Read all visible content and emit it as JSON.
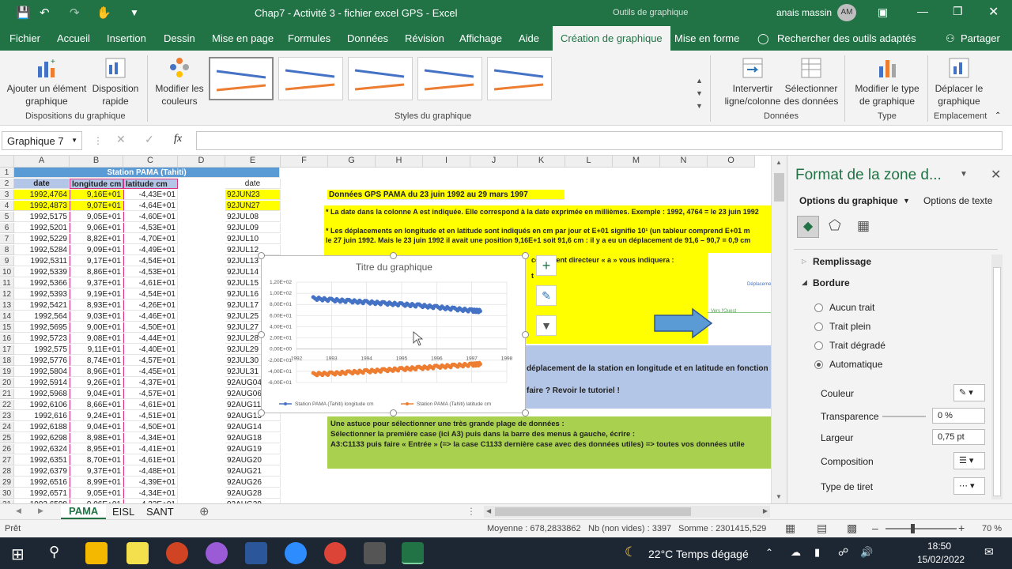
{
  "window": {
    "title": "Chap7 - Activité 3 - fichier excel GPS  -  Excel",
    "context_tools": "Outils de graphique",
    "user": "anais massin",
    "user_initials": "AM"
  },
  "menu": {
    "tabs": [
      "Fichier",
      "Accueil",
      "Insertion",
      "Dessin",
      "Mise en page",
      "Formules",
      "Données",
      "Révision",
      "Affichage",
      "Aide",
      "Création de graphique",
      "Mise en forme"
    ],
    "search": "Rechercher des outils adaptés",
    "share": "Partager"
  },
  "ribbon": {
    "add_element": "Ajouter un élément graphique",
    "quick_layout": "Disposition rapide",
    "group1": "Dispositions du graphique",
    "change_colors": "Modifier les couleurs",
    "group2": "Styles du graphique",
    "switch_row_col": "Intervertir ligne/colonne",
    "select_data": "Sélectionner des données",
    "group3": "Données",
    "change_type": "Modifier le type de graphique",
    "group4": "Type",
    "move_chart": "Déplacer le graphique",
    "group5": "Emplacement"
  },
  "formula": {
    "namebox": "Graphique 7",
    "fx": "fx",
    "value": ""
  },
  "columns": [
    "A",
    "B",
    "C",
    "D",
    "E",
    "F",
    "G",
    "H",
    "I",
    "J",
    "K",
    "L",
    "M",
    "N",
    "O"
  ],
  "header_row1": "Station  PAMA (Tahiti)",
  "header_row2": {
    "a": "date",
    "b": "longitude cm",
    "c": "latitude cm",
    "e": "date"
  },
  "rows": [
    {
      "n": "3",
      "a": "1992,4764",
      "b": "9,16E+01",
      "c": "-4,43E+01",
      "e": "92JUN23"
    },
    {
      "n": "4",
      "a": "1992,4873",
      "b": "9,07E+01",
      "c": "-4,64E+01",
      "e": "92JUN27"
    },
    {
      "n": "5",
      "a": "1992,5175",
      "b": "9,05E+01",
      "c": "-4,60E+01",
      "e": "92JUL08"
    },
    {
      "n": "6",
      "a": "1992,5201",
      "b": "9,06E+01",
      "c": "-4,53E+01",
      "e": "92JUL09"
    },
    {
      "n": "7",
      "a": "1992,5229",
      "b": "8,82E+01",
      "c": "-4,70E+01",
      "e": "92JUL10"
    },
    {
      "n": "8",
      "a": "1992,5284",
      "b": "9,09E+01",
      "c": "-4,49E+01",
      "e": "92JUL12"
    },
    {
      "n": "9",
      "a": "1992,5311",
      "b": "9,17E+01",
      "c": "-4,54E+01",
      "e": "92JUL13"
    },
    {
      "n": "10",
      "a": "1992,5339",
      "b": "8,86E+01",
      "c": "-4,53E+01",
      "e": "92JUL14"
    },
    {
      "n": "11",
      "a": "1992,5366",
      "b": "9,37E+01",
      "c": "-4,61E+01",
      "e": "92JUL15"
    },
    {
      "n": "12",
      "a": "1992,5393",
      "b": "9,19E+01",
      "c": "-4,54E+01",
      "e": "92JUL16"
    },
    {
      "n": "13",
      "a": "1992,5421",
      "b": "8,93E+01",
      "c": "-4,26E+01",
      "e": "92JUL17"
    },
    {
      "n": "14",
      "a": "1992,564",
      "b": "9,03E+01",
      "c": "-4,46E+01",
      "e": "92JUL25"
    },
    {
      "n": "15",
      "a": "1992,5695",
      "b": "9,00E+01",
      "c": "-4,50E+01",
      "e": "92JUL27"
    },
    {
      "n": "16",
      "a": "1992,5723",
      "b": "9,08E+01",
      "c": "-4,44E+01",
      "e": "92JUL28"
    },
    {
      "n": "17",
      "a": "1992,575",
      "b": "9,11E+01",
      "c": "-4,40E+01",
      "e": "92JUL29"
    },
    {
      "n": "18",
      "a": "1992,5776",
      "b": "8,74E+01",
      "c": "-4,57E+01",
      "e": "92JUL30"
    },
    {
      "n": "19",
      "a": "1992,5804",
      "b": "8,96E+01",
      "c": "-4,45E+01",
      "e": "92JUL31"
    },
    {
      "n": "20",
      "a": "1992,5914",
      "b": "9,26E+01",
      "c": "-4,37E+01",
      "e": "92AUG04"
    },
    {
      "n": "21",
      "a": "1992,5968",
      "b": "9,04E+01",
      "c": "-4,57E+01",
      "e": "92AUG06"
    },
    {
      "n": "22",
      "a": "1992,6106",
      "b": "8,66E+01",
      "c": "-4,61E+01",
      "e": "92AUG11"
    },
    {
      "n": "23",
      "a": "1992,616",
      "b": "9,24E+01",
      "c": "-4,51E+01",
      "e": "92AUG13"
    },
    {
      "n": "24",
      "a": "1992,6188",
      "b": "9,04E+01",
      "c": "-4,50E+01",
      "e": "92AUG14"
    },
    {
      "n": "25",
      "a": "1992,6298",
      "b": "8,98E+01",
      "c": "-4,34E+01",
      "e": "92AUG18"
    },
    {
      "n": "26",
      "a": "1992,6324",
      "b": "8,95E+01",
      "c": "-4,41E+01",
      "e": "92AUG19"
    },
    {
      "n": "27",
      "a": "1992,6351",
      "b": "8,70E+01",
      "c": "-4,61E+01",
      "e": "92AUG20"
    },
    {
      "n": "28",
      "a": "1992,6379",
      "b": "9,37E+01",
      "c": "-4,48E+01",
      "e": "92AUG21"
    },
    {
      "n": "29",
      "a": "1992,6516",
      "b": "8,99E+01",
      "c": "-4,39E+01",
      "e": "92AUG26"
    },
    {
      "n": "30",
      "a": "1992,6571",
      "b": "9,05E+01",
      "c": "-4,34E+01",
      "e": "92AUG28"
    },
    {
      "n": "31",
      "a": "1992,6598",
      "b": "9,06E+01",
      "c": "-4,22E+01",
      "e": "92AUG29"
    },
    {
      "n": "32",
      "a": "1992,6626",
      "b": "8,70E+01",
      "c": "-4,31E+01",
      "e": "92AUG30"
    }
  ],
  "notes": {
    "title": "Données GPS PAMA du 23 juin 1992 au 29 mars 1997",
    "n1": "* La date dans la colonne A est indiquée. Elle correspond à la date exprimée en millièmes. Exemple : 1992, 4764 = le 23 juin 1992",
    "n2a": "* Les déplacements en longitude et en latitude sont indiqués en cm par jour et E+01 signifie 10¹   (un tableur comprend E+01 m",
    "n2b": "le 27 juin 1992. Mais le 23 juin 1992 il avait une position 9,16E+1 soit 91,6 cm : il y a eu un déplacement de 91,6 – 90,7 = 0,9 cm",
    "n3": "coefficient directeur « a » vous indiquera :",
    "n3b": "t",
    "blue1": "déplacement de la station en longitude et en latitude en fonction",
    "blue2": "faire ? Revoir le tutoriel !",
    "tip1": "Une astuce pour sélectionner une très grande plage de données :",
    "tip2": "Sélectionner la première case (ici A3) puis dans la barre des menus à gauche, écrire :",
    "tip3": "A3:C1133  puis faire « Entrée »    (=> la case C1133 dernière case avec des données utiles) => toutes vos données utile",
    "img_text1": "Déplacement",
    "img_text2": "Vers l'Ouest"
  },
  "chart_data": {
    "type": "scatter",
    "title": "Titre du graphique",
    "xlim": [
      1992,
      1998
    ],
    "x_ticks": [
      "1992",
      "1993",
      "1994",
      "1995",
      "1996",
      "1997",
      "1998"
    ],
    "ylim": [
      -60,
      120
    ],
    "y_ticks": [
      "1,20E+02",
      "1,00E+02",
      "8,00E+01",
      "6,00E+01",
      "4,00E+01",
      "2,00E+01",
      "0,00E+00",
      "-2,00E+01",
      "-4,00E+01",
      "-6,00E+01"
    ],
    "series": [
      {
        "name": "Station  PAMA (Tahiti) longitude cm",
        "color": "#4472c4",
        "x": [
          1992.48,
          1993,
          1993.5,
          1994,
          1994.5,
          1995,
          1995.5,
          1996,
          1996.5,
          1997,
          1997.24
        ],
        "y": [
          91,
          88,
          86,
          84,
          82,
          80,
          78,
          75,
          72,
          69,
          68
        ]
      },
      {
        "name": "Station  PAMA (Tahiti) latitude cm",
        "color": "#ed7d31",
        "x": [
          1992.48,
          1993,
          1993.5,
          1994,
          1994.5,
          1995,
          1995.5,
          1996,
          1996.5,
          1997,
          1997.24
        ],
        "y": [
          -45,
          -44,
          -42,
          -40,
          -38,
          -36,
          -34,
          -32,
          -30,
          -28,
          -27
        ]
      }
    ]
  },
  "pane": {
    "title": "Format de la zone d...",
    "tab1": "Options du graphique",
    "tab2": "Options de texte",
    "fill": "Remplissage",
    "border": "Bordure",
    "opt1": "Aucun trait",
    "opt2": "Trait plein",
    "opt3": "Trait dégradé",
    "opt4": "Automatique",
    "color": "Couleur",
    "transparency": "Transparence",
    "transparency_val": "0 %",
    "width": "Largeur",
    "width_val": "0,75 pt",
    "composition": "Composition",
    "dash": "Type de tiret"
  },
  "sheets": [
    "PAMA",
    "EISL",
    "SANT"
  ],
  "status": {
    "ready": "Prêt",
    "avg": "Moyenne : 678,2833862",
    "count": "Nb (non vides) : 3397",
    "sum": "Somme : 2301415,529",
    "zoom": "70 %"
  },
  "taskbar": {
    "weather": "22°C  Temps dégagé",
    "time": "18:50",
    "date": "15/02/2022"
  }
}
